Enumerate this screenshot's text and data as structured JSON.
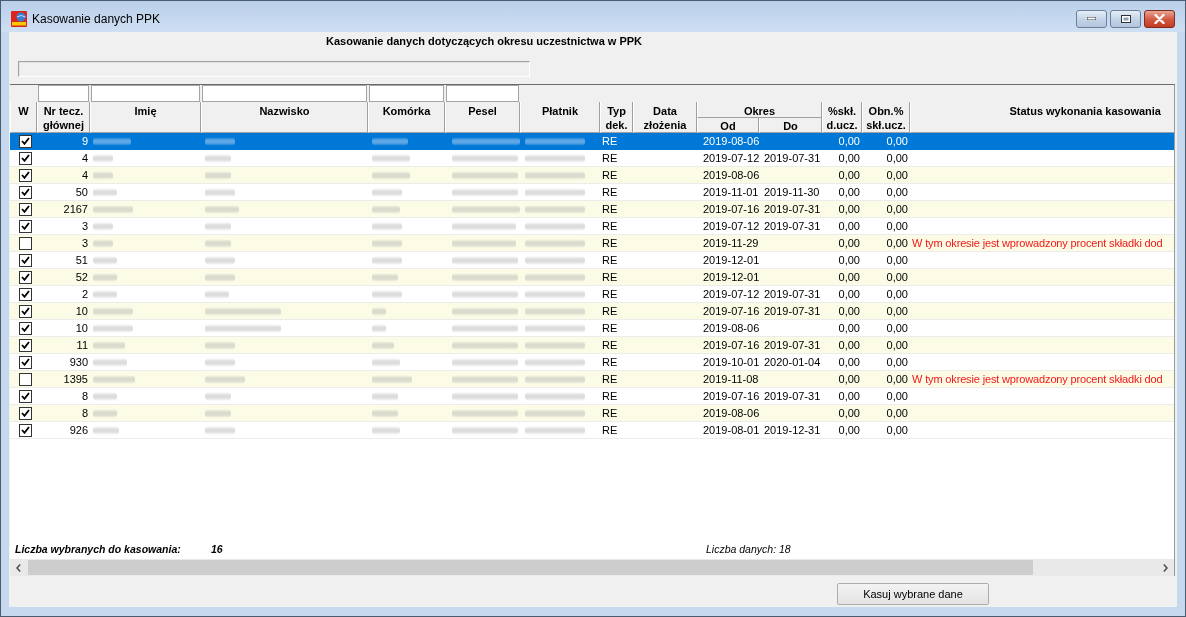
{
  "window": {
    "title": "Kasowanie danych PPK"
  },
  "heading": "Kasowanie danych dotyczących okresu uczestnictwa w PPK",
  "table": {
    "columns": [
      {
        "label": "W",
        "filter": false
      },
      {
        "label": "Nr tecz.\ngłównej",
        "filter": true
      },
      {
        "label": "Imię",
        "filter": true
      },
      {
        "label": "Nazwisko",
        "filter": true
      },
      {
        "label": "Komórka",
        "filter": true
      },
      {
        "label": "Pesel",
        "filter": true
      },
      {
        "label": "Płatnik",
        "filter": false
      },
      {
        "label": "Typ\ndek.",
        "filter": false
      },
      {
        "label": "Data\nzłożenia",
        "filter": false
      },
      {
        "label": "Okres",
        "filter": false,
        "children": [
          {
            "label": "Od"
          },
          {
            "label": "Do"
          }
        ]
      },
      {
        "label": "%skł.\nd.ucz.",
        "filter": false
      },
      {
        "label": "Obn.%\nskł.ucz.",
        "filter": false
      },
      {
        "label": "Status wykonania kasowania",
        "filter": false
      }
    ],
    "rows": [
      {
        "checked": true,
        "selected": true,
        "nr": "9",
        "typ": "RE",
        "od": "2019-08-06",
        "skl": "0,00",
        "obn": "0,00"
      },
      {
        "checked": true,
        "selected": false,
        "nr": "4",
        "typ": "RE",
        "od": "2019-07-12",
        "do": "2019-07-31",
        "skl": "0,00",
        "obn": "0,00"
      },
      {
        "checked": true,
        "selected": false,
        "nr": "4",
        "typ": "RE",
        "od": "2019-08-06",
        "skl": "0,00",
        "obn": "0,00"
      },
      {
        "checked": true,
        "selected": false,
        "nr": "50",
        "typ": "RE",
        "od": "2019-11-01",
        "do": "2019-11-30",
        "skl": "0,00",
        "obn": "0,00"
      },
      {
        "checked": true,
        "selected": false,
        "nr": "2167",
        "typ": "RE",
        "od": "2019-07-16",
        "do": "2019-07-31",
        "skl": "0,00",
        "obn": "0,00"
      },
      {
        "checked": true,
        "selected": false,
        "nr": "3",
        "typ": "RE",
        "od": "2019-07-12",
        "do": "2019-07-31",
        "skl": "0,00",
        "obn": "0,00"
      },
      {
        "checked": false,
        "selected": false,
        "nr": "3",
        "typ": "RE",
        "od": "2019-11-29",
        "skl": "0,00",
        "obn": "0,00",
        "status": "W tym okresie jest wprowadzony procent składki dod"
      },
      {
        "checked": true,
        "selected": false,
        "nr": "51",
        "typ": "RE",
        "od": "2019-12-01",
        "skl": "0,00",
        "obn": "0,00"
      },
      {
        "checked": true,
        "selected": false,
        "nr": "52",
        "typ": "RE",
        "od": "2019-12-01",
        "skl": "0,00",
        "obn": "0,00"
      },
      {
        "checked": true,
        "selected": false,
        "nr": "2",
        "typ": "RE",
        "od": "2019-07-12",
        "do": "2019-07-31",
        "skl": "0,00",
        "obn": "0,00"
      },
      {
        "checked": true,
        "selected": false,
        "nr": "10",
        "typ": "RE",
        "od": "2019-07-16",
        "do": "2019-07-31",
        "skl": "0,00",
        "obn": "0,00"
      },
      {
        "checked": true,
        "selected": false,
        "nr": "10",
        "typ": "RE",
        "od": "2019-08-06",
        "skl": "0,00",
        "obn": "0,00"
      },
      {
        "checked": true,
        "selected": false,
        "nr": "11",
        "typ": "RE",
        "od": "2019-07-16",
        "do": "2019-07-31",
        "skl": "0,00",
        "obn": "0,00"
      },
      {
        "checked": true,
        "selected": false,
        "nr": "930",
        "typ": "RE",
        "od": "2019-10-01",
        "do": "2020-01-04",
        "skl": "0,00",
        "obn": "0,00"
      },
      {
        "checked": false,
        "selected": false,
        "nr": "1395",
        "typ": "RE",
        "od": "2019-11-08",
        "skl": "0,00",
        "obn": "0,00",
        "status": "W tym okresie jest wprowadzony procent składki dod"
      },
      {
        "checked": true,
        "selected": false,
        "nr": "8",
        "typ": "RE",
        "od": "2019-07-16",
        "do": "2019-07-31",
        "skl": "0,00",
        "obn": "0,00"
      },
      {
        "checked": true,
        "selected": false,
        "nr": "8",
        "typ": "RE",
        "od": "2019-08-06",
        "skl": "0,00",
        "obn": "0,00"
      },
      {
        "checked": true,
        "selected": false,
        "nr": "926",
        "typ": "RE",
        "od": "2019-08-01",
        "do": "2019-12-31",
        "skl": "0,00",
        "obn": "0,00"
      }
    ]
  },
  "footer": {
    "selected_label": "Liczba wybranych do kasowania:",
    "selected_count": "16",
    "total": "Liczba danych: 18"
  },
  "button": "Kasuj wybrane dane"
}
